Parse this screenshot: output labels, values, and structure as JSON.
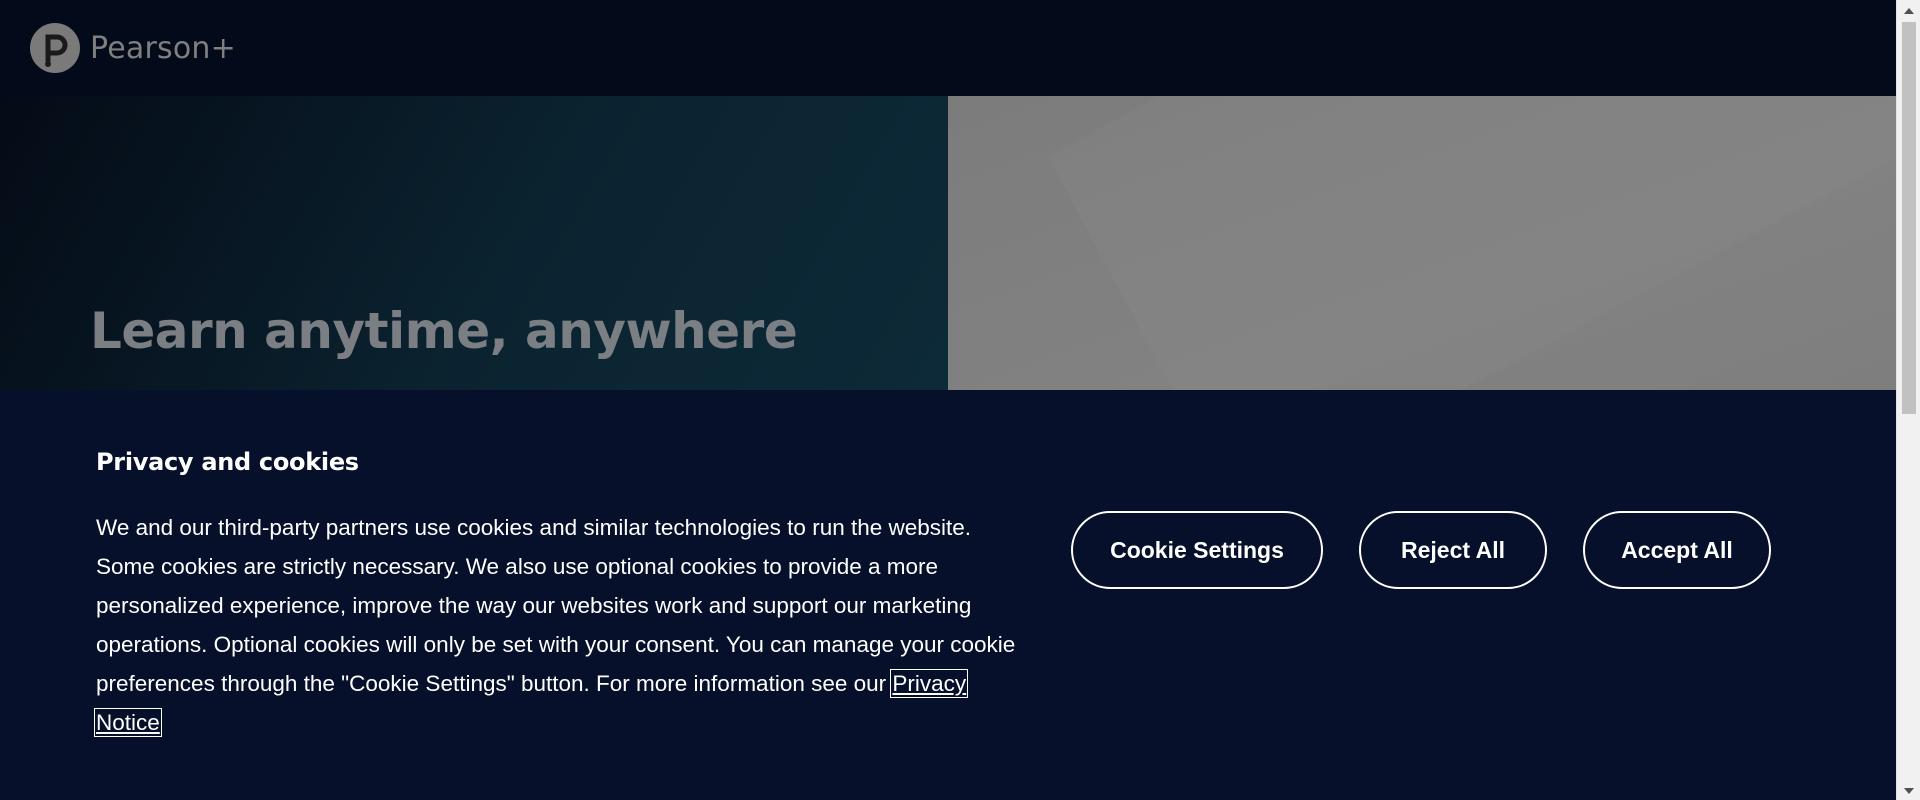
{
  "header": {
    "logo_text": "Pearson+"
  },
  "hero": {
    "title": "Learn anytime, anywhere"
  },
  "cookie_banner": {
    "title": "Privacy and cookies",
    "body": "We and our third-party partners use cookies and similar technologies to run the website. Some cookies are strictly necessary. We also use optional cookies to provide a more personalized experience, improve the way our websites work and support our marketing operations. Optional cookies will only be set with your consent. You can manage your cookie preferences through the \"Cookie Settings\" button. For more information see our",
    "privacy_link": "Privacy Notice",
    "buttons": {
      "settings": "Cookie Settings",
      "reject": "Reject All",
      "accept": "Accept All"
    }
  },
  "colors": {
    "banner_bg": "#06102a",
    "header_bg": "#030a1a",
    "button_border": "#ffffff",
    "text": "#ffffff"
  },
  "icons": {
    "logo": "pearson-p-logo-icon",
    "scroll_up": "triangle-up-icon",
    "scroll_down": "triangle-down-icon"
  }
}
